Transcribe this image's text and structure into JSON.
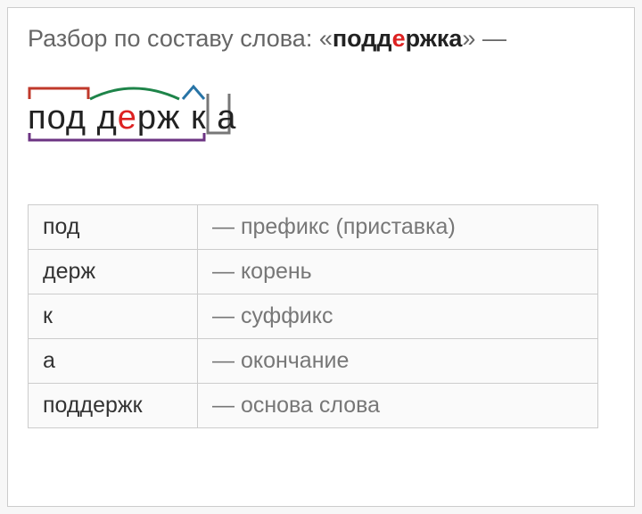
{
  "title_prefix": "Разбор по составу слова: «",
  "title_word_pre": "подд",
  "title_word_hl": "е",
  "title_word_post": "ржка",
  "title_suffix": "» —",
  "morph": {
    "p1": "под д",
    "hl": "е",
    "p2": "рж к а"
  },
  "table": [
    {
      "m": "под",
      "d": "— префикс (приставка)"
    },
    {
      "m": "держ",
      "d": "— корень"
    },
    {
      "m": "к",
      "d": "— суффикс"
    },
    {
      "m": "а",
      "d": "— окончание"
    },
    {
      "m": "поддержк",
      "d": "— основа слова"
    }
  ]
}
